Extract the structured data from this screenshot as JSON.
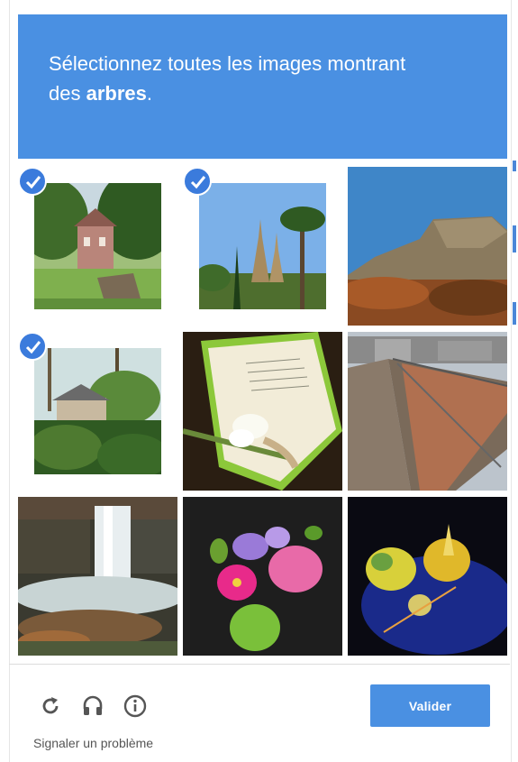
{
  "challenge": {
    "instruction_prefix": "Sélectionnez toutes les images montrant",
    "instruction_middle": "des ",
    "keyword": "arbres",
    "instruction_suffix": "."
  },
  "grid": {
    "tiles": [
      {
        "subject": "manor house with trees",
        "selected": true
      },
      {
        "subject": "palm trees and cathedral",
        "selected": true
      },
      {
        "subject": "mountain cliff landscape",
        "selected": false
      },
      {
        "subject": "house in forest",
        "selected": true
      },
      {
        "subject": "wedding card with lily",
        "selected": false
      },
      {
        "subject": "bridge with love locks",
        "selected": false
      },
      {
        "subject": "waterfall",
        "selected": false
      },
      {
        "subject": "flower bouquet",
        "selected": false
      },
      {
        "subject": "plated dessert",
        "selected": false
      }
    ]
  },
  "toolbar": {
    "icons": [
      "reload-icon",
      "headphones-icon",
      "info-icon"
    ],
    "submit_label": "Valider",
    "report_label": "Signaler un problème"
  },
  "colors": {
    "accent": "#4a90e2",
    "check": "#3b7bdc"
  }
}
